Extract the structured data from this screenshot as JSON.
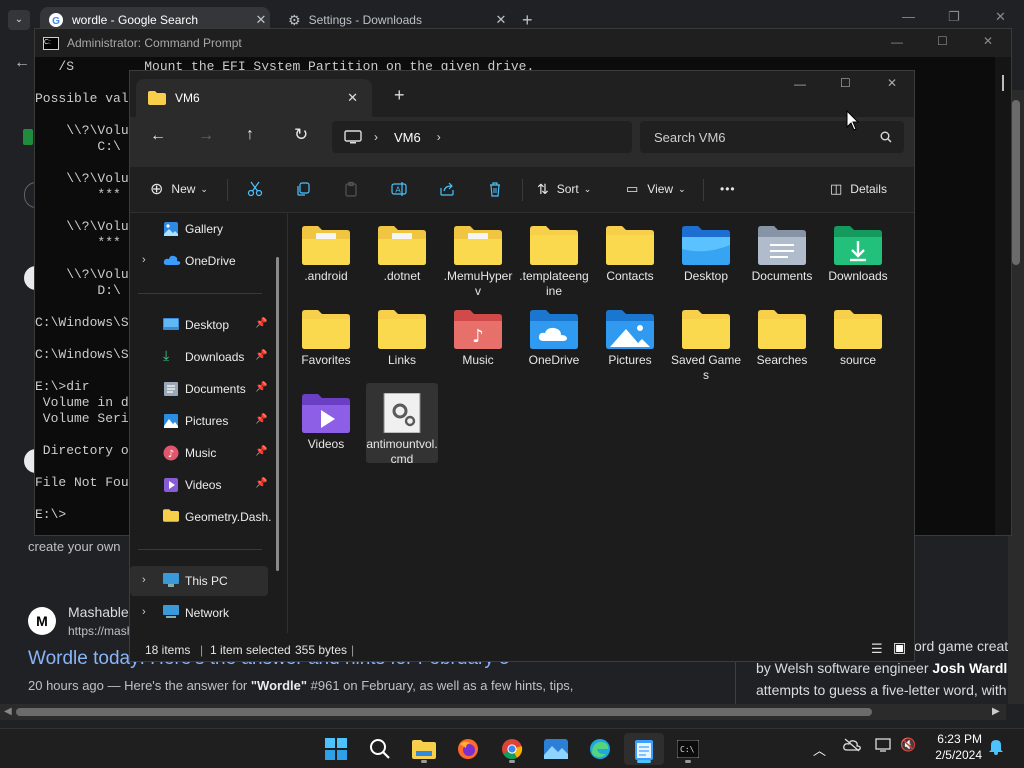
{
  "chrome": {
    "tabs": [
      {
        "title": "wordle - Google Search",
        "active": true
      },
      {
        "title": "Settings - Downloads",
        "active": false
      }
    ],
    "new_tab": "+",
    "search_results": {
      "snippet_create": "create your own",
      "source_name": "Mashable",
      "source_url": "https://mash",
      "result_title": "Wordle today: Here's the answer and hints for February 5",
      "result_meta": "20 hours ago — Here's the answer for ",
      "result_bold": "\"Wordle\"",
      "result_rest": " #961 on February, as well as a few hints, tips,",
      "side_line1": "ord game creat",
      "side_line2_a": "by Welsh software engineer ",
      "side_line2_b": "Josh Wardle",
      "side_line3": "attempts to guess a five-letter word, with",
      "side_small": "e"
    }
  },
  "cmd": {
    "title": "Administrator: Command Prompt",
    "lines": [
      "   /S         Mount the EFI System Partition on the given drive.",
      "",
      "Possible val",
      "",
      "    \\\\?\\Volu",
      "        C:\\",
      "",
      "    \\\\?\\Volu",
      "        ***",
      "",
      "    \\\\?\\Volu",
      "        ***",
      "",
      "    \\\\?\\Volu",
      "        D:\\",
      "",
      "C:\\Windows\\S",
      "",
      "C:\\Windows\\S",
      "",
      "E:\\>dir",
      " Volume in d",
      " Volume Seri",
      "",
      " Directory o",
      "",
      "File Not Fou",
      "",
      "E:\\>"
    ]
  },
  "explorer": {
    "tab_title": "VM6",
    "new_tab": "+",
    "breadcrumb": [
      "VM6"
    ],
    "search_placeholder": "Search VM6",
    "toolbar": {
      "new": "New",
      "sort": "Sort",
      "view": "View",
      "more": "•••",
      "details": "Details"
    },
    "nav": {
      "gallery": "Gallery",
      "onedrive": "OneDrive",
      "desktop": "Desktop",
      "downloads": "Downloads",
      "documents": "Documents",
      "pictures": "Pictures",
      "music": "Music",
      "videos": "Videos",
      "geometry": "Geometry.Dash.",
      "this_pc": "This PC",
      "network": "Network"
    },
    "items": [
      {
        "name": ".android",
        "icon": "folder-doc-icon"
      },
      {
        "name": ".dotnet",
        "icon": "folder-doc-icon"
      },
      {
        "name": ".MemuHyperv",
        "icon": "folder-doc-icon"
      },
      {
        "name": ".templateengine",
        "icon": "folder-icon"
      },
      {
        "name": "Contacts",
        "icon": "folder-icon"
      },
      {
        "name": "Desktop",
        "icon": "desktop-folder-icon"
      },
      {
        "name": "Documents",
        "icon": "documents-folder-icon"
      },
      {
        "name": "Downloads",
        "icon": "downloads-folder-icon"
      },
      {
        "name": "Favorites",
        "icon": "folder-icon"
      },
      {
        "name": "Links",
        "icon": "folder-icon"
      },
      {
        "name": "Music",
        "icon": "music-folder-icon"
      },
      {
        "name": "OneDrive",
        "icon": "onedrive-folder-icon"
      },
      {
        "name": "Pictures",
        "icon": "pictures-folder-icon"
      },
      {
        "name": "Saved Games",
        "icon": "folder-icon"
      },
      {
        "name": "Searches",
        "icon": "folder-icon"
      },
      {
        "name": "source",
        "icon": "folder-icon"
      },
      {
        "name": "Videos",
        "icon": "videos-folder-icon"
      },
      {
        "name": "antimountvol.cmd",
        "icon": "cmd-file-icon",
        "selected": true
      }
    ],
    "status": {
      "count": "18 items",
      "selected": "1 item selected",
      "size": "355 bytes"
    }
  },
  "taskbar": {
    "apps": [
      "start-icon",
      "search-icon",
      "file-explorer-icon",
      "firefox-icon",
      "chrome-icon",
      "photos-icon",
      "edge-icon",
      "notepad-icon",
      "terminal-icon"
    ],
    "time": "6:23 PM",
    "date": "2/5/2024"
  },
  "colors": {
    "accent": "#4cc2ff",
    "folder": "#f8cf4a",
    "link": "#8ab4f8"
  }
}
